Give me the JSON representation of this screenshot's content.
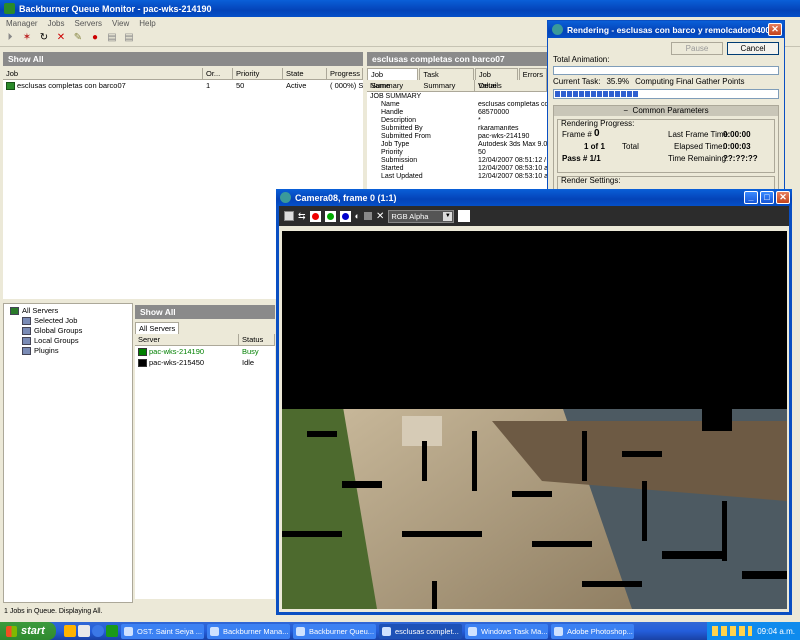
{
  "main": {
    "title": "Backburner Queue Monitor - pac-wks-214190",
    "menu": [
      "Manager",
      "Jobs",
      "Servers",
      "View",
      "Help"
    ],
    "jobs_header": "Show All",
    "job_columns": [
      "Job",
      "Or...",
      "Priority",
      "State",
      "Progress"
    ],
    "job_rows": [
      {
        "name": "esclusas completas con barco07",
        "order": "1",
        "priority": "50",
        "state": "Active",
        "progress": "( 000%) S"
      }
    ],
    "detail_title": "esclusas completas con barco07",
    "detail_tabs": [
      "Job Summary",
      "Task Summary",
      "Job Details",
      "Errors"
    ],
    "detail_columns": [
      "Name",
      "Value"
    ],
    "detail_section": "JOB SUMMARY",
    "detail_rows": [
      {
        "name": "Name",
        "value": "esclusas completas co"
      },
      {
        "name": "Handle",
        "value": "68570000"
      },
      {
        "name": "Description",
        "value": "*"
      },
      {
        "name": "Submitted By",
        "value": "rkaramanites"
      },
      {
        "name": "Submitted From",
        "value": "pac-wks-214190"
      },
      {
        "name": "Job Type",
        "value": "Autodesk 3ds Max 9.0"
      },
      {
        "name": "Priority",
        "value": "50"
      },
      {
        "name": "Submission",
        "value": "12/04/2007 08:51:12 /"
      },
      {
        "name": "Started",
        "value": "12/04/2007 08:53:10 a"
      },
      {
        "name": "Last Updated",
        "value": "12/04/2007 08:53:10 a"
      }
    ],
    "tree": [
      {
        "label": "All Servers",
        "level": 0
      },
      {
        "label": "Selected Job",
        "level": 1
      },
      {
        "label": "Global Groups",
        "level": 1
      },
      {
        "label": "Local Groups",
        "level": 1
      },
      {
        "label": "Plugins",
        "level": 1
      }
    ],
    "servers_header": "Show All",
    "servers_tab": "All Servers",
    "server_columns": [
      "Server",
      "Status"
    ],
    "server_rows": [
      {
        "name": "pac-wks-214190",
        "status": "Busy"
      },
      {
        "name": "pac-wks-215450",
        "status": "Idle"
      }
    ],
    "status_text": "1 Jobs in Queue. Displaying All."
  },
  "render_dialog": {
    "title": "Rendering - esclusas con barco y remolcador0400...",
    "pause_label": "Pause",
    "cancel_label": "Cancel",
    "total_animation_label": "Total Animation:",
    "current_task_label": "Current Task:",
    "current_task_pct": "35.9%",
    "current_task_text": "Computing Final Gather Points",
    "current_task_progress": 0.359,
    "common_params": "Common Parameters",
    "rendering_progress": "Rendering Progress:",
    "frame_label": "Frame #",
    "frame_value": "0",
    "of_value": "1 of 1",
    "total_label": "Total",
    "pass_value": "Pass # 1/1",
    "last_frame_time_label": "Last Frame Time:",
    "last_frame_time": "0:00:00",
    "elapsed_time_label": "Elapsed Time:",
    "elapsed_time": "0:00:03",
    "time_remaining_label": "Time Remaining:",
    "time_remaining": "??:??:??",
    "render_settings": "Render Settings:"
  },
  "camera": {
    "title": "Camera08, frame 0 (1:1)",
    "channel": "RGB Alpha"
  },
  "taskbar": {
    "start": "start",
    "buttons": [
      "OST. Saint Seiya ...",
      "Backburner Mana...",
      "Backburner Queu...",
      "esclusas complet...",
      "Windows Task Ma...",
      "Adobe Photoshop..."
    ],
    "active_index": 3,
    "time": "09:04 a.m."
  },
  "colors": {
    "xp_blue": "#0a4fc2",
    "server_busy": "#008000",
    "progress_blue": "#2f5fd0"
  }
}
